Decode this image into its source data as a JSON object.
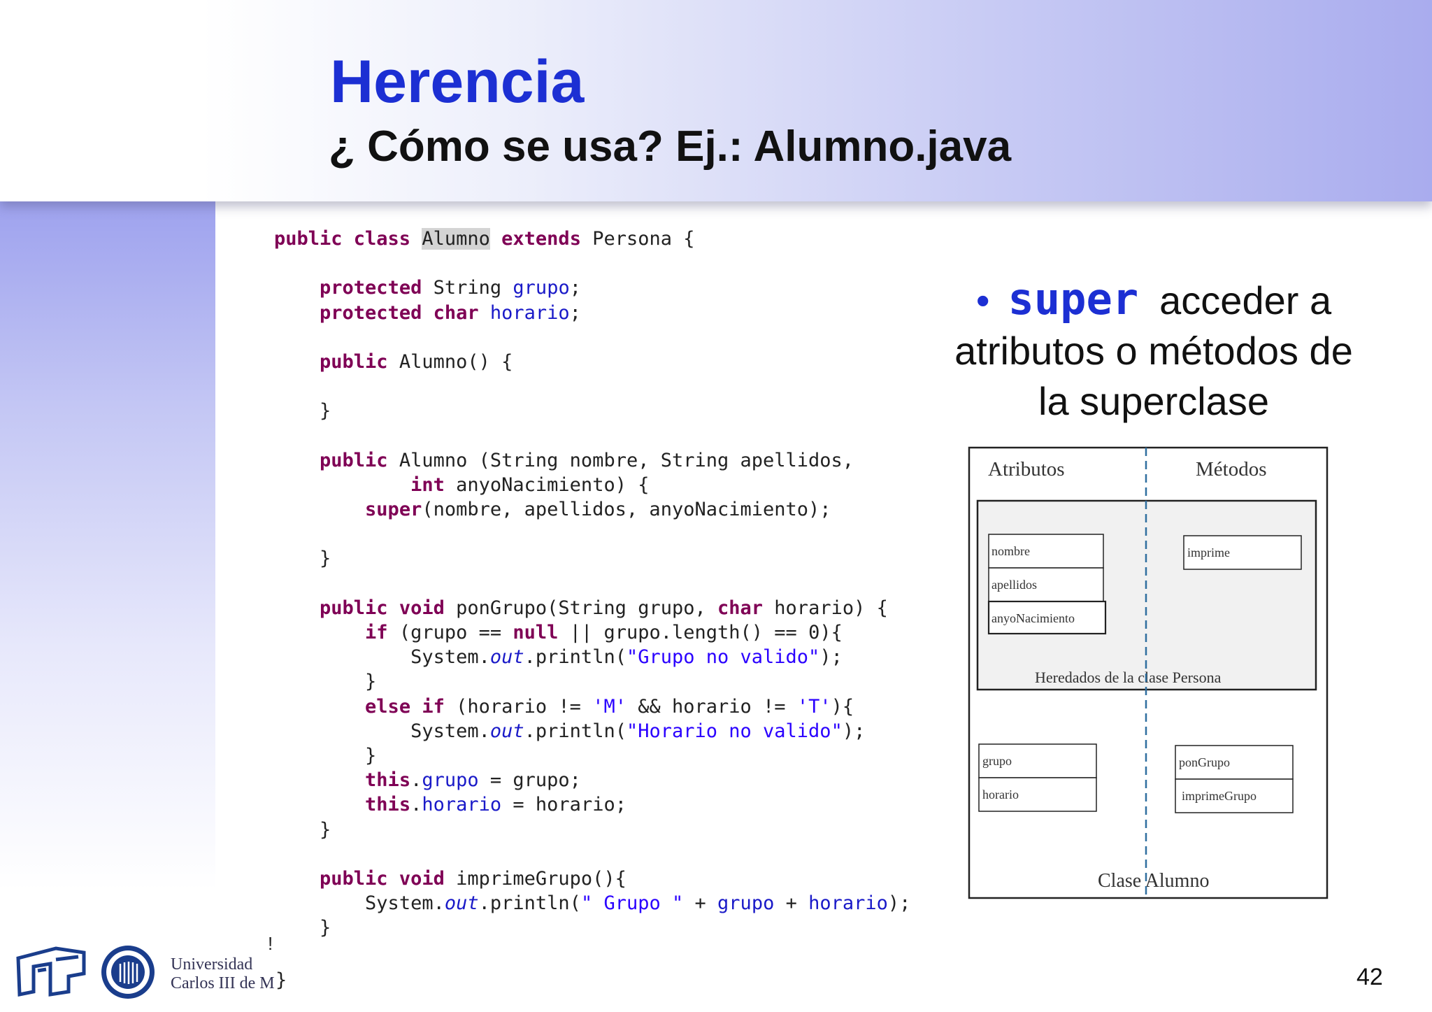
{
  "title": "Herencia",
  "subtitle": "¿ Cómo se usa? Ej.: Alumno.java",
  "code": {
    "l1_kw1": "public class",
    "l1_name": "Alumno",
    "l1_kw2": "extends",
    "l1_rest": "Persona {",
    "l2_kw": "protected",
    "l2_type": "String",
    "l2_field": "grupo",
    "l3_kw": "protected char",
    "l3_field": "horario",
    "l4_kw": "public",
    "l4_rest": "Alumno() {",
    "l5": "}",
    "l6_kw": "public",
    "l6_rest": "Alumno (String nombre, String apellidos,",
    "l7_kw": "int",
    "l7_rest": "anyoNacimiento) {",
    "l8_kw": "super",
    "l8_rest": "(nombre, apellidos, anyoNacimiento);",
    "l9": "}",
    "l10_kw1": "public void",
    "l10_mid": "ponGrupo(String grupo,",
    "l10_kw2": "char",
    "l10_rest": "horario) {",
    "l11_kw1": "if",
    "l11_mid": "(grupo ==",
    "l11_kw2": "null",
    "l11_rest": "|| grupo.length() == 0){",
    "l12_pre": "System.",
    "l12_out": "out",
    "l12_mid": ".println(",
    "l12_str": "\"Grupo no valido\"",
    "l12_end": ");",
    "l13": "}",
    "l14_kw": "else if",
    "l14_mid": "(horario !=",
    "l14_s1": "'M'",
    "l14_mid2": "&& horario !=",
    "l14_s2": "'T'",
    "l14_end": "){",
    "l15_pre": "System.",
    "l15_out": "out",
    "l15_mid": ".println(",
    "l15_str": "\"Horario no valido\"",
    "l15_end": ");",
    "l16": "}",
    "l17_kw": "this",
    "l17_field": "grupo",
    "l17_rest": "= grupo;",
    "l18_kw": "this",
    "l18_field": "horario",
    "l18_rest": "= horario;",
    "l19": "}",
    "l20_kw": "public void",
    "l20_rest": "imprimeGrupo(){",
    "l21_pre": "System.",
    "l21_out": "out",
    "l21_mid": ".println(",
    "l21_str": "\" Grupo \"",
    "l21_plus1": "+",
    "l21_f1": "grupo",
    "l21_plus2": "+",
    "l21_f2": "horario",
    "l21_end": ");",
    "l22": "}",
    "last_brace": "}",
    "stray_mark": "!"
  },
  "bullet": {
    "dot": "•",
    "keyword": "super",
    "line1": "acceder a",
    "line2": "atributos o métodos de",
    "line3": "la superclase"
  },
  "diagram": {
    "col_attributes": "Atributos",
    "col_methods": "Métodos",
    "inherited": [
      "nombre",
      "apellidos",
      "anyoNacimiento"
    ],
    "inherited_methods": [
      "imprime"
    ],
    "inherited_label": "Heredados de la clase Persona",
    "own_attributes": [
      "grupo",
      "horario"
    ],
    "own_methods": [
      "ponGrupo",
      "imprimeGrupo"
    ],
    "class_label": "Clase Alumno"
  },
  "footer": {
    "university_line1": "Universidad",
    "university_line2": "Carlos III de M",
    "page_number": "42"
  },
  "colors": {
    "title": "#1c2fd3",
    "keyword": "#7f0055",
    "field": "#1a1ac8",
    "string": "#2a00ff",
    "header_gradient_end": "#a9acee"
  }
}
